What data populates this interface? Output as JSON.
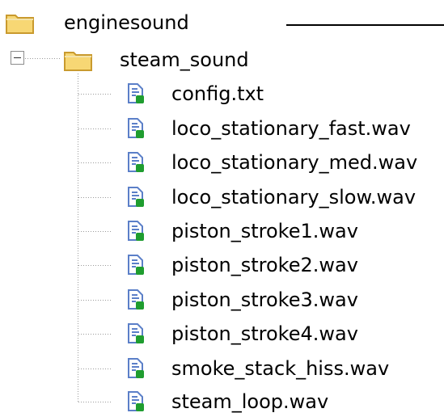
{
  "tree": {
    "root": {
      "label": "enginesound",
      "icon": "folder-icon"
    },
    "folder": {
      "label": "steam_sound",
      "icon": "folder-icon",
      "expanded": true
    },
    "files": [
      {
        "label": "config.txt",
        "icon": "file-icon"
      },
      {
        "label": "loco_stationary_fast.wav",
        "icon": "file-icon"
      },
      {
        "label": "loco_stationary_med.wav",
        "icon": "file-icon"
      },
      {
        "label": "loco_stationary_slow.wav",
        "icon": "file-icon"
      },
      {
        "label": "piston_stroke1.wav",
        "icon": "file-icon"
      },
      {
        "label": "piston_stroke2.wav",
        "icon": "file-icon"
      },
      {
        "label": "piston_stroke3.wav",
        "icon": "file-icon"
      },
      {
        "label": "piston_stroke4.wav",
        "icon": "file-icon"
      },
      {
        "label": "smoke_stack_hiss.wav",
        "icon": "file-icon"
      },
      {
        "label": "steam_loop.wav",
        "icon": "file-icon"
      }
    ]
  },
  "colors": {
    "folder_fill": "#f7d774",
    "folder_stroke": "#c99a2e",
    "file_blue": "#5b7fc8",
    "file_green": "#1f9d2f",
    "tree_line": "#9a9a9a",
    "text": "#000000"
  }
}
